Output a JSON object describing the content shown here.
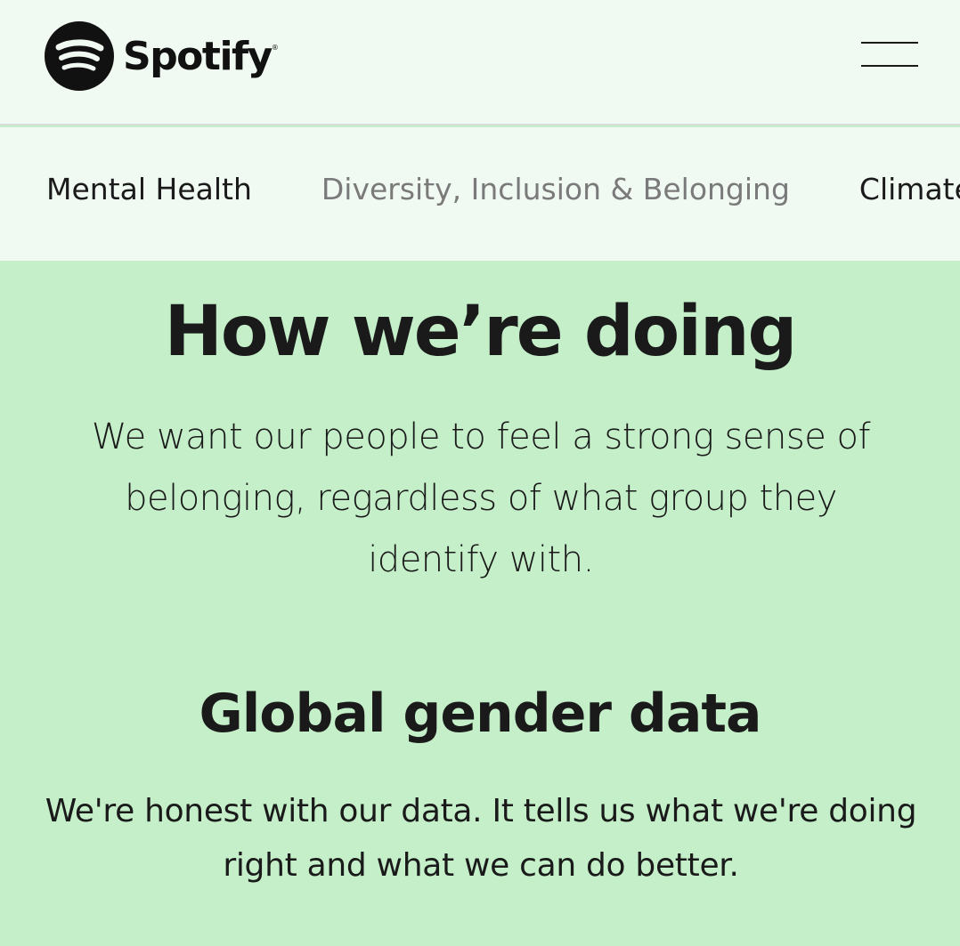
{
  "header": {
    "brand": "Spotify",
    "brand_reg": "®",
    "logo_icon": "spotify-logo-icon",
    "menu_icon": "hamburger-menu-icon"
  },
  "subnav": {
    "items": [
      {
        "label": "Mental Health"
      },
      {
        "label": "Diversity, Inclusion & Belonging"
      },
      {
        "label": "Climate Action"
      }
    ]
  },
  "main": {
    "title": "How we’re doing",
    "lead": "We want our people to feel a strong sense of belonging, regardless of what group they identify with.",
    "section_title": "Global gender data",
    "section_text": "We're honest with our data. It tells us what we're doing right and what we can do better."
  },
  "colors": {
    "header_bg": "#f1faf2",
    "content_bg": "#c4efc9",
    "text": "#1a1a1a",
    "muted_text": "#7a7a7a"
  }
}
